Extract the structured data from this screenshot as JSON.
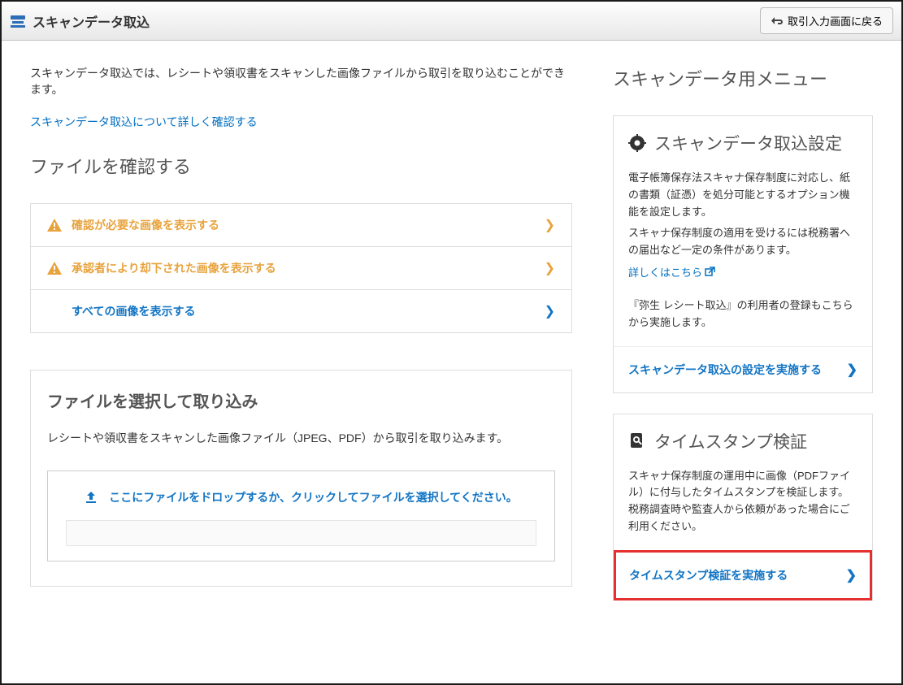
{
  "header": {
    "title": "スキャンデータ取込",
    "back_label": "取引入力画面に戻る"
  },
  "intro": {
    "text": "スキャンデータ取込では、レシートや領収書をスキャンした画像ファイルから取引を取り込むことができます。",
    "link": "スキャンデータ取込について詳しく確認する"
  },
  "files": {
    "title": "ファイルを確認する",
    "rows": {
      "need_confirm": "確認が必要な画像を表示する",
      "rejected": "承認者により却下された画像を表示する",
      "all": "すべての画像を表示する"
    }
  },
  "import": {
    "title": "ファイルを選択して取り込み",
    "desc": "レシートや領収書をスキャンした画像ファイル（JPEG、PDF）から取引を取り込みます。",
    "dropzone": "ここにファイルをドロップするか、クリックしてファイルを選択してください。"
  },
  "side": {
    "title": "スキャンデータ用メニュー",
    "settings": {
      "title": "スキャンデータ取込設定",
      "text1": "電子帳簿保存法スキャナ保存制度に対応し、紙の書類（証憑）を処分可能とするオプション機能を設定します。",
      "text2": "スキャナ保存制度の適用を受けるには税務署への届出など一定の条件があります。",
      "link": "詳しくはこちら",
      "note": "『弥生 レシート取込』の利用者の登録もこちらから実施します。",
      "action": "スキャンデータ取込の設定を実施する"
    },
    "timestamp": {
      "title": "タイムスタンプ検証",
      "text": "スキャナ保存制度の運用中に画像（PDFファイル）に付与したタイムスタンプを検証します。税務調査時や監査人から依頼があった場合にご利用ください。",
      "action": "タイムスタンプ検証を実施する"
    }
  }
}
